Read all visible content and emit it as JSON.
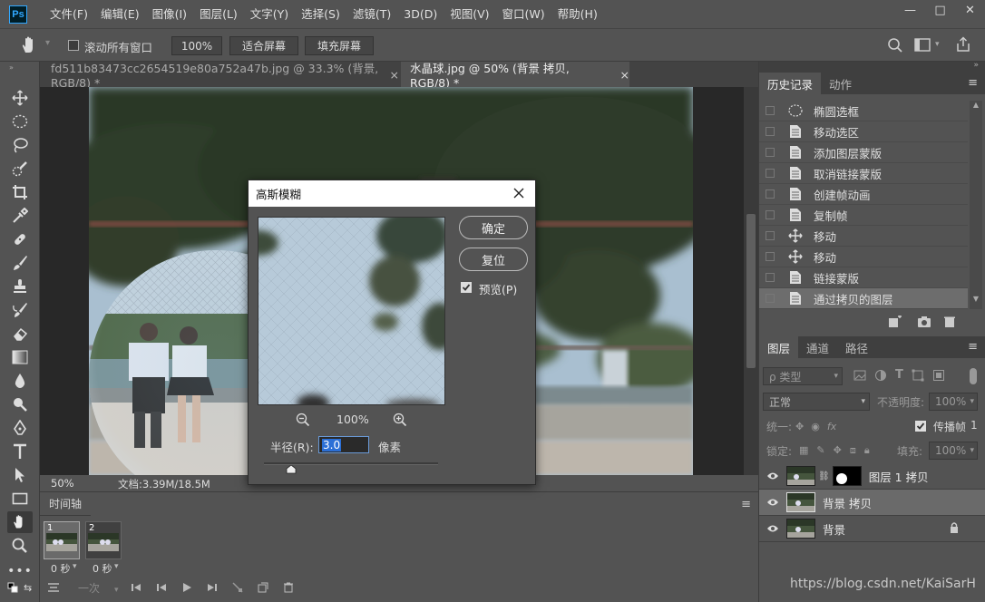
{
  "menu": {
    "logo": "Ps",
    "items": [
      "文件(F)",
      "编辑(E)",
      "图像(I)",
      "图层(L)",
      "文字(Y)",
      "选择(S)",
      "滤镜(T)",
      "3D(D)",
      "视图(V)",
      "窗口(W)",
      "帮助(H)"
    ]
  },
  "window_controls": {
    "minimize": "—",
    "maximize": "□",
    "close": "✕"
  },
  "options": {
    "scroll_all": "滚动所有窗口",
    "zoom_100": "100%",
    "fit_screen": "适合屏幕",
    "fill_screen": "填充屏幕"
  },
  "doc_tabs": [
    {
      "label": "fd511b83473cc2654519e80a752a47b.jpg @ 33.3% (背景, RGB/8) *",
      "close": "×"
    },
    {
      "label": "水晶球.jpg @ 50% (背景 拷贝, RGB/8) *",
      "close": "×"
    }
  ],
  "status": {
    "zoom": "50%",
    "doc": "文档:3.39M/18.5M"
  },
  "timeline": {
    "tab": "时间轴",
    "frames": [
      {
        "num": "1",
        "time": "0 秒"
      },
      {
        "num": "2",
        "time": "0 秒"
      }
    ],
    "loop": "一次"
  },
  "history": {
    "tabs": [
      "历史记录",
      "动作"
    ],
    "items": [
      {
        "label": "椭圆选框",
        "icon": "ellipse-marquee-icon"
      },
      {
        "label": "移动选区",
        "icon": "document-icon"
      },
      {
        "label": "添加图层蒙版",
        "icon": "document-icon"
      },
      {
        "label": "取消链接蒙版",
        "icon": "document-icon"
      },
      {
        "label": "创建帧动画",
        "icon": "document-icon"
      },
      {
        "label": "复制帧",
        "icon": "document-icon"
      },
      {
        "label": "移动",
        "icon": "move-icon"
      },
      {
        "label": "移动",
        "icon": "move-icon"
      },
      {
        "label": "链接蒙版",
        "icon": "document-icon"
      },
      {
        "label": "通过拷贝的图层",
        "icon": "document-icon"
      }
    ]
  },
  "layers": {
    "tabs": [
      "图层",
      "通道",
      "路径"
    ],
    "filter": "ρ 类型",
    "blend_mode": "正常",
    "opacity_label": "不透明度:",
    "opacity_value": "100%",
    "unify_label": "统一:",
    "propagate_label": "传播帧",
    "propagate_value": "1",
    "lock_label": "锁定:",
    "fill_label": "填充:",
    "fill_value": "100%",
    "items": [
      {
        "name": "图层 1 拷贝"
      },
      {
        "name": "背景 拷贝"
      },
      {
        "name": "背景"
      }
    ]
  },
  "dialog": {
    "title": "高斯模糊",
    "ok": "确定",
    "reset": "复位",
    "preview": "预览(P)",
    "zoom": "100%",
    "radius_label": "半径(R):",
    "radius_value": "3.0",
    "unit": "像素"
  },
  "watermark": "https://blog.csdn.net/KaiSarH",
  "colors": {
    "accent": "#31a8ff",
    "ui_bg": "#535353",
    "dark_bg": "#282828"
  }
}
